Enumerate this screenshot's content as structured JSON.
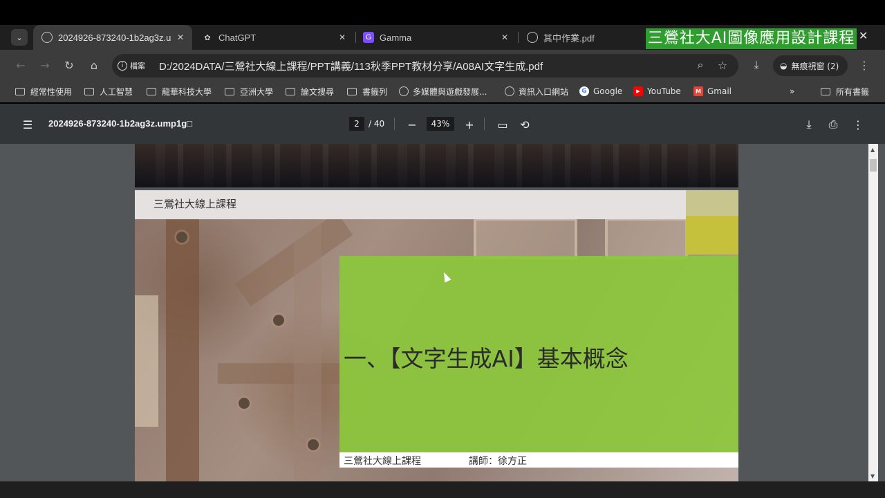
{
  "tabs": [
    {
      "title": "2024926-873240-1b2ag3z.u",
      "favicon": "globe-icon",
      "active": true
    },
    {
      "title": "ChatGPT",
      "favicon": "openai-icon",
      "active": false
    },
    {
      "title": "Gamma",
      "favicon": "gamma-icon",
      "active": false
    },
    {
      "title": "其中作業.pdf",
      "favicon": "globe-icon",
      "active": false
    }
  ],
  "banner": "三鶯社大AI圖像應用設計課程",
  "address": {
    "site_label": "檔案",
    "url": "D:/2024DATA/三鶯社大線上課程/PPT講義/113秋季PPT教材分享/A08AI文字生成.pdf"
  },
  "incognito_label": "無痕視窗 (2)",
  "bookmarks": [
    {
      "label": "經常性使用",
      "icon": "folder-icon"
    },
    {
      "label": "人工智慧",
      "icon": "folder-icon"
    },
    {
      "label": "龍華科技大學",
      "icon": "folder-icon"
    },
    {
      "label": "亞洲大學",
      "icon": "folder-icon"
    },
    {
      "label": "論文搜尋",
      "icon": "folder-icon"
    },
    {
      "label": "書籤列",
      "icon": "folder-icon"
    },
    {
      "label": "多媒體與遊戲發展...",
      "icon": "globe-icon"
    },
    {
      "label": "資訊入口網站",
      "icon": "globe-icon"
    },
    {
      "label": "Google",
      "icon": "google-icon"
    },
    {
      "label": "YouTube",
      "icon": "youtube-icon"
    },
    {
      "label": "Gmail",
      "icon": "gmail-icon"
    }
  ],
  "all_bookmarks_label": "所有書籤",
  "more_bookmarks": "»",
  "pdf": {
    "filename": "2024926-873240-1b2ag3z.ump1g□",
    "current_page": "2",
    "total_pages": "/ 40",
    "zoom": "43%"
  },
  "slide": {
    "header": "三鶯社大線上課程",
    "title": "一、【文字生成AI】基本概念",
    "footer_left": "三鶯社大線上課程",
    "footer_right": "講師：徐方正"
  },
  "colors": {
    "banner_green": "#2e9e2e",
    "slide_green": "#8cc83c",
    "toolbar": "#3c3c3c",
    "pdf_bar": "#323639"
  }
}
